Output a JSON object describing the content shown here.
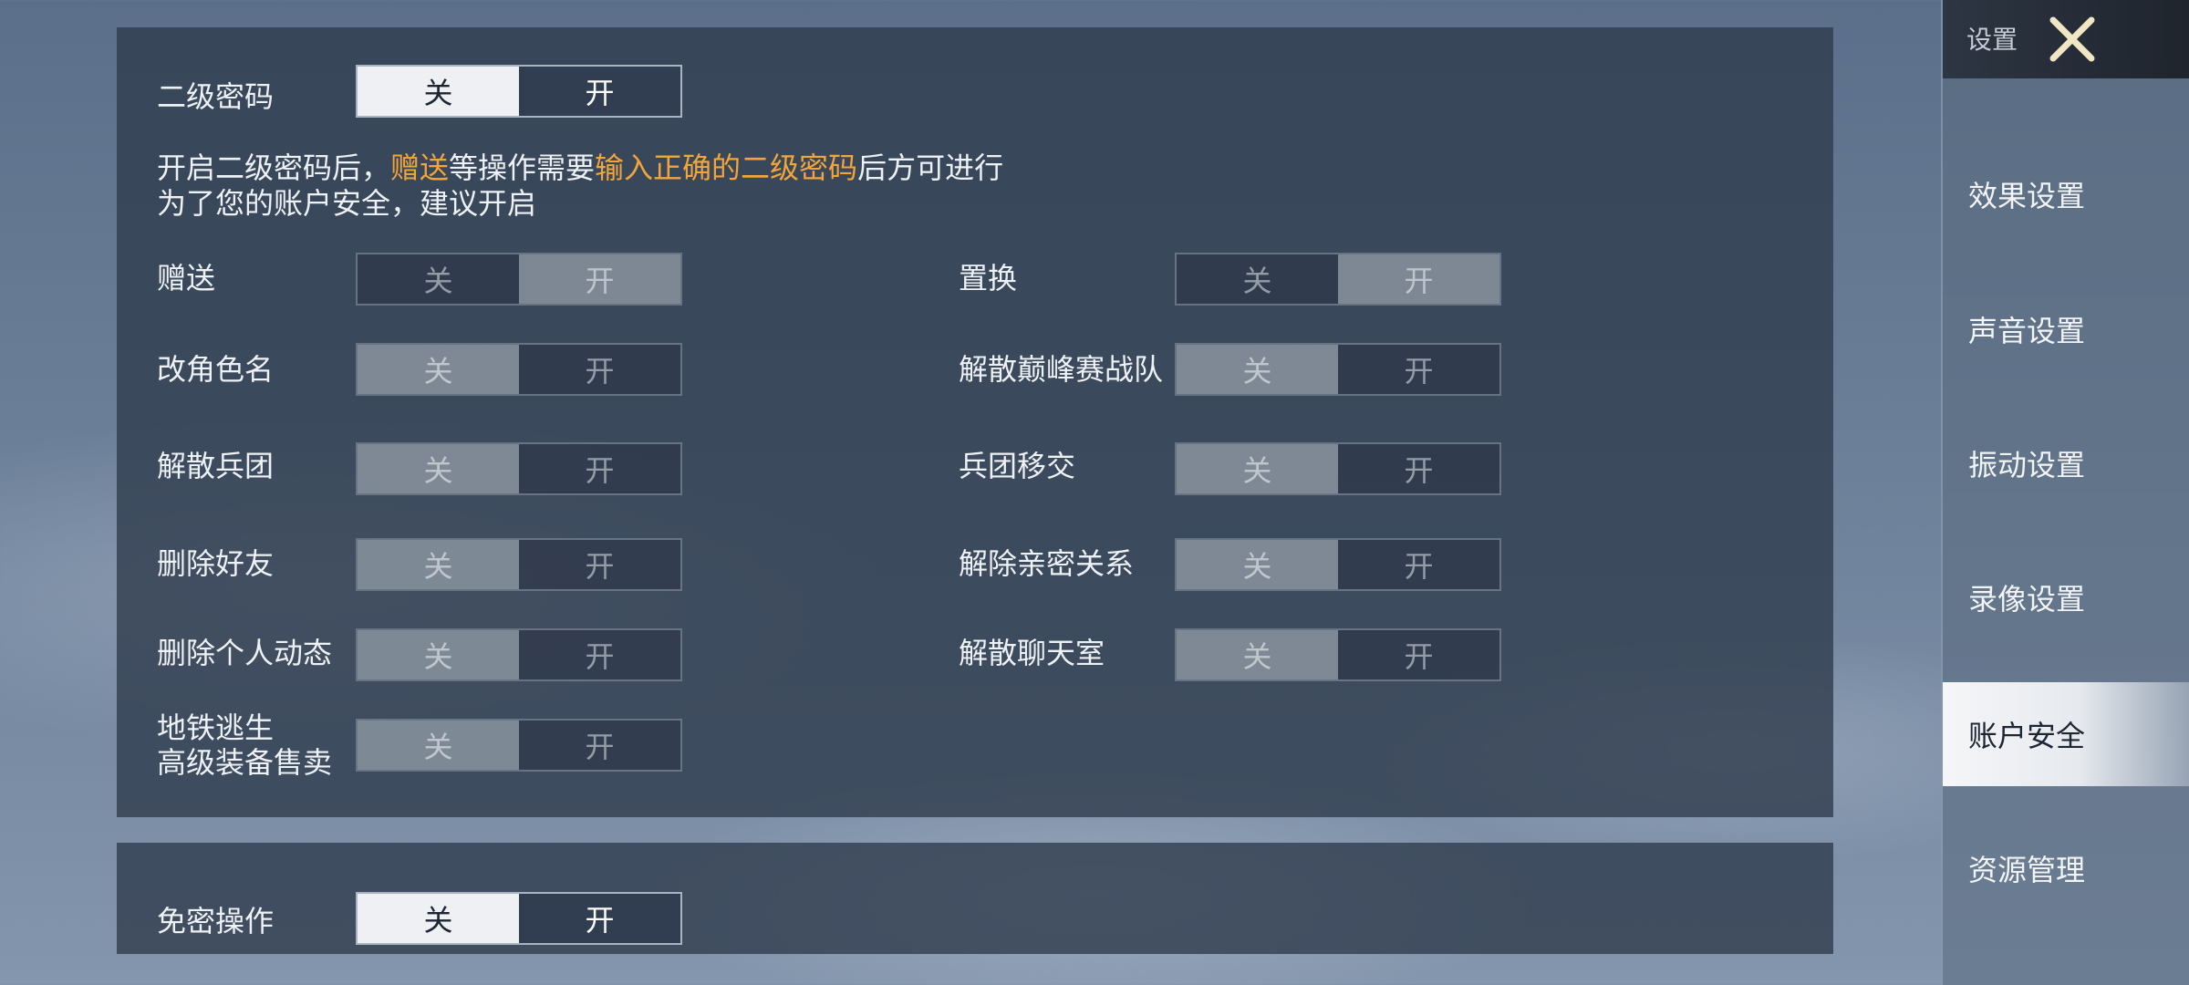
{
  "toggle_labels": {
    "off": "关",
    "on": "开"
  },
  "secondary_password": {
    "label": "二级密码",
    "state": "off",
    "desc_line1_a": "开启二级密码后，",
    "desc_line1_b": "赠送",
    "desc_line1_c": "等操作需要",
    "desc_line1_d": "输入正确的二级密码",
    "desc_line1_e": "后方可进行",
    "desc_line2": "为了您的账户安全，建议开启",
    "highlight_color": "#f2a63a"
  },
  "options": [
    {
      "label": "赠送",
      "state": "on"
    },
    {
      "label": "置换",
      "state": "on"
    },
    {
      "label": "改角色名",
      "state": "off"
    },
    {
      "label": "解散巅峰赛战队",
      "state": "off"
    },
    {
      "label": "解散兵团",
      "state": "off"
    },
    {
      "label": "兵团移交",
      "state": "off"
    },
    {
      "label": "删除好友",
      "state": "off"
    },
    {
      "label": "解除亲密关系",
      "state": "off"
    },
    {
      "label": "删除个人动态",
      "state": "off"
    },
    {
      "label": "解散聊天室",
      "state": "off"
    },
    {
      "label_line1": "地铁逃生",
      "label_line2": "高级装备售卖",
      "state": "off"
    }
  ],
  "password_free": {
    "label": "免密操作",
    "state": "off"
  },
  "sidebar": {
    "title": "设置",
    "close_icon": "close-x-icon",
    "items": [
      {
        "label": "效果设置",
        "active": false
      },
      {
        "label": "声音设置",
        "active": false
      },
      {
        "label": "振动设置",
        "active": false
      },
      {
        "label": "录像设置",
        "active": false
      },
      {
        "label": "账户安全",
        "active": true
      },
      {
        "label": "资源管理",
        "active": false
      }
    ]
  }
}
